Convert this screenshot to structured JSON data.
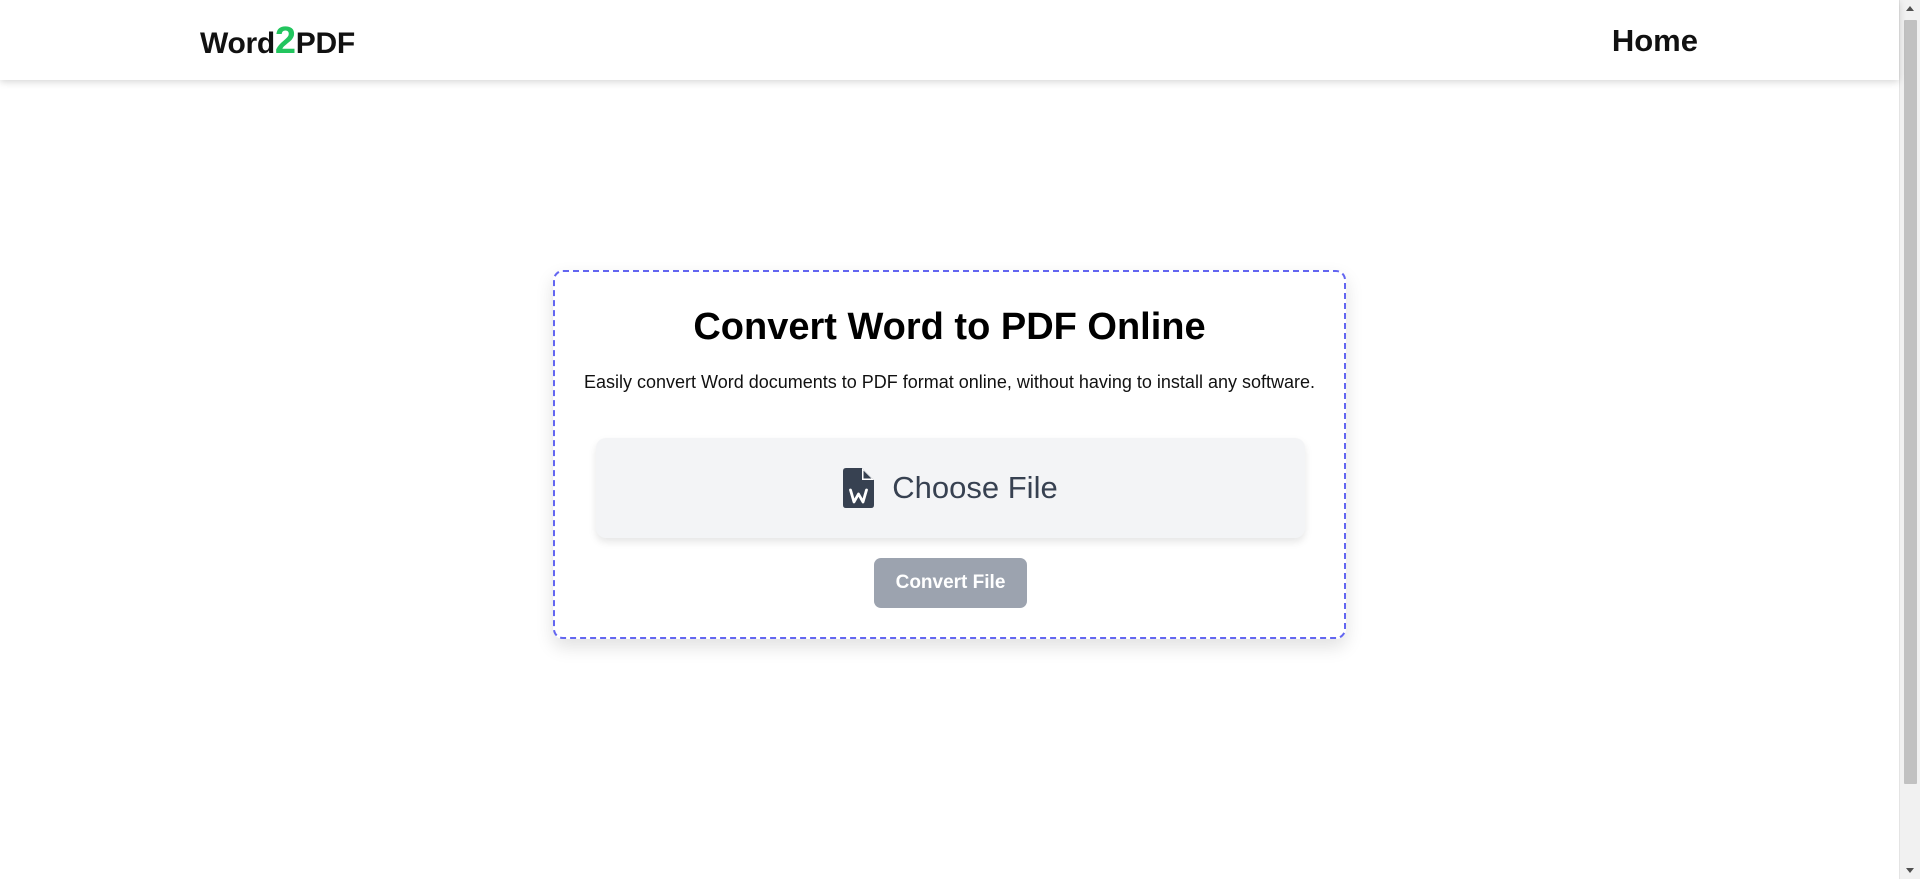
{
  "navbar": {
    "brand_part1": "Word",
    "brand_part2": "2",
    "brand_part3": "PDF",
    "home_link": "Home"
  },
  "converter": {
    "title": "Convert Word to PDF Online",
    "description": "Easily convert Word documents to PDF format online, without having to install any software.",
    "choose_file_label": "Choose File",
    "choose_file_icon": "word-file-icon",
    "convert_button_label": "Convert File"
  },
  "colors": {
    "accent_green": "#22c55e",
    "card_border": "#6366f1",
    "disabled_button": "#9ca3af",
    "dropzone_bg": "#f3f4f6"
  }
}
